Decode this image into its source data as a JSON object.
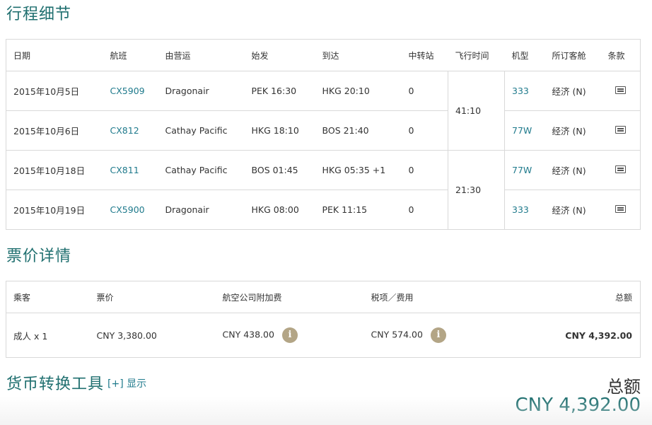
{
  "itinerary": {
    "title": "行程细节",
    "headers": [
      "日期",
      "航班",
      "由营运",
      "始发",
      "到达",
      "中转站",
      "飞行时间",
      "机型",
      "所订客舱",
      "条款"
    ],
    "rows": [
      {
        "date": "2015年10月5日",
        "flight": "CX5909",
        "operator": "Dragonair",
        "depart": "PEK 16:30",
        "arrive": "HKG 20:10",
        "stops": "0",
        "aircraft": "333",
        "cabin": "经济 (N)"
      },
      {
        "date": "2015年10月6日",
        "flight": "CX812",
        "operator": "Cathay Pacific",
        "depart": "HKG 18:10",
        "arrive": "BOS 21:40",
        "stops": "0",
        "aircraft": "77W",
        "cabin": "经济 (N)"
      },
      {
        "date": "2015年10月18日",
        "flight": "CX811",
        "operator": "Cathay Pacific",
        "depart": "BOS 01:45",
        "arrive": "HKG 05:35 +1",
        "stops": "0",
        "aircraft": "77W",
        "cabin": "经济 (N)"
      },
      {
        "date": "2015年10月19日",
        "flight": "CX5900",
        "operator": "Dragonair",
        "depart": "HKG 08:00",
        "arrive": "PEK 11:15",
        "stops": "0",
        "aircraft": "333",
        "cabin": "经济 (N)"
      }
    ],
    "durations": [
      "41:10",
      "21:30"
    ],
    "terms_icon": "document-icon"
  },
  "fare": {
    "title": "票价详情",
    "headers": {
      "passenger": "乘客",
      "fare": "票价",
      "surcharge": "航空公司附加费",
      "tax": "税项／费用",
      "total": "总额"
    },
    "row": {
      "passenger": "成人 x 1",
      "fare": "CNY 3,380.00",
      "surcharge": "CNY 438.00",
      "tax": "CNY 574.00",
      "total": "CNY 4,392.00"
    },
    "info_glyph": "i"
  },
  "converter": {
    "title": "货币转换工具",
    "toggle_label": "[+] 显示"
  },
  "summary": {
    "total_label": "总额",
    "total_amount": "CNY 4,392.00"
  },
  "colors": {
    "accent": "#1f6f6f",
    "link": "#1f7a8c",
    "info": "#b3a586",
    "border": "#d9d9d9"
  }
}
